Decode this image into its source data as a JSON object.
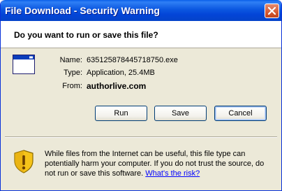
{
  "window": {
    "title": "File Download - Security Warning",
    "close_icon": "close-icon"
  },
  "header": {
    "question": "Do you want to run or save this file?"
  },
  "file": {
    "icon": "application-window-icon",
    "name_label": "Name:",
    "name_value": "635125878445718750.exe",
    "type_label": "Type:",
    "type_value": "Application, 25.4MB",
    "from_label": "From:",
    "from_value": "authorlive.com"
  },
  "buttons": {
    "run": "Run",
    "save": "Save",
    "cancel": "Cancel"
  },
  "warning": {
    "icon": "security-shield-warning-icon",
    "text": "While files from the Internet can be useful, this file type can potentially harm your computer. If you do not trust the source, do not run or save this software.",
    "link": "What's the risk?"
  },
  "colors": {
    "titlebar": "#0a5fe9",
    "close_button": "#d75a32",
    "dialog_bg": "#ece9d8",
    "link": "#0000ff",
    "shield_yellow": "#f5c31a"
  }
}
